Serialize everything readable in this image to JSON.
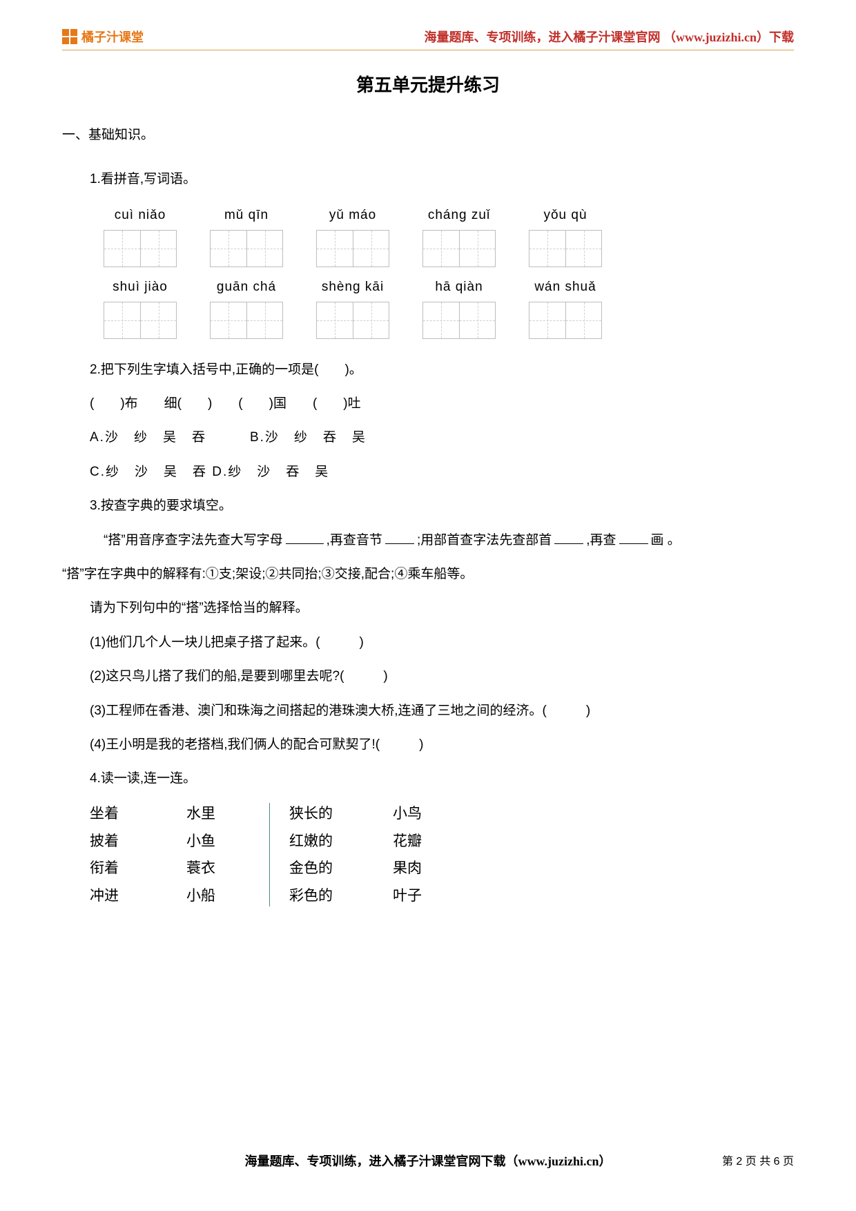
{
  "header": {
    "brand": "橘子汁课堂",
    "note": "海量题库、专项训练，进入橘子汁课堂官网 （www.juzizhi.cn）下载"
  },
  "title": "第五单元提升练习",
  "section1": "一、基础知识。",
  "q1": "1.看拼音,写词语。",
  "pinyin_row1": [
    "cuì niǎo",
    "mǔ qīn",
    "yǔ máo",
    "cháng zuǐ",
    "yǒu qù"
  ],
  "pinyin_row2": [
    "shuì jiào",
    "guān chá",
    "shèng kāi",
    "hā qiàn",
    "wán shuǎ"
  ],
  "q2": "2.把下列生字填入括号中,正确的一项是(　　)。",
  "q2_line": "(　　)布　　细(　　)　　(　　)国　　(　　)吐",
  "q2_opts1": "A.沙　纱　吴　吞　　　B.沙　纱　吞　吴",
  "q2_opts2": "C.纱　沙　吴　吞  D.纱　沙　吞　吴",
  "q3": "3.按查字典的要求填空。",
  "q3_p1a": "“搭”用音序查字法先查大写字母",
  "q3_p1b": ",再查音节",
  "q3_p1c": ";用部首查字法先查部首",
  "q3_p1d": ",再查",
  "q3_p1e": "画 。",
  "q3_p2": "“搭”字在字典中的解释有:①支;架设;②共同抬;③交接,配合;④乘车船等。",
  "q3_p3": "请为下列句中的“搭”选择恰当的解释。",
  "q3_s1": "(1)他们几个人一块儿把桌子搭了起来。(　　　)",
  "q3_s2": "(2)这只鸟儿搭了我们的船,是要到哪里去呢?(　　　)",
  "q3_s3": "(3)工程师在香港、澳门和珠海之间搭起的港珠澳大桥,连通了三地之间的经济。(　　　)",
  "q3_s4": "(4)王小明是我的老搭档,我们俩人的配合可默契了!(　　　)",
  "q4": "4.读一读,连一连。",
  "match": {
    "colA": [
      "坐着",
      "披着",
      "衔着",
      "冲进"
    ],
    "colB": [
      "水里",
      "小鱼",
      "蓑衣",
      "小船"
    ],
    "colC": [
      "狭长的",
      "红嫩的",
      "金色的",
      "彩色的"
    ],
    "colD": [
      "小鸟",
      "花瓣",
      "果肉",
      "叶子"
    ]
  },
  "footer": {
    "text": "海量题库、专项训练，进入橘子汁课堂官网下载（www.juzizhi.cn）",
    "page": "第 2 页 共 6 页"
  }
}
